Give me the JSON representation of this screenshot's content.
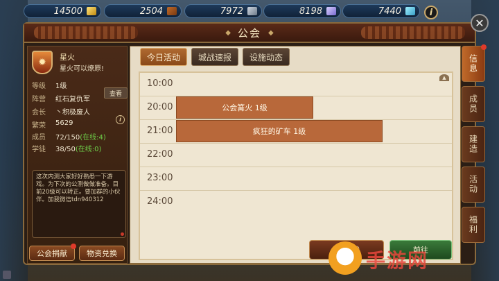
{
  "resources": [
    {
      "name": "gold",
      "value": "14500",
      "icon": "gold-icon"
    },
    {
      "name": "wood",
      "value": "2504",
      "icon": "wood-icon"
    },
    {
      "name": "iron",
      "value": "7972",
      "icon": "iron-icon"
    },
    {
      "name": "crystal",
      "value": "8198",
      "icon": "crystal-icon"
    },
    {
      "name": "gem",
      "value": "7440",
      "icon": "gem-icon"
    }
  ],
  "window": {
    "title": "公会",
    "close_label": "✕"
  },
  "guild": {
    "emblem_icon": "flame-emblem-icon",
    "name": "星火",
    "motto": "星火可以燎原!",
    "fields": [
      {
        "label": "等级",
        "value": "1级"
      },
      {
        "label": "阵营",
        "value": "红石复仇军"
      },
      {
        "label": "会长",
        "value": "丶积极废人"
      },
      {
        "label": "繁荣",
        "value": "5629"
      },
      {
        "label": "成员",
        "value": "72/150",
        "extra": "(在线:4)"
      },
      {
        "label": "学徒",
        "value": "38/50",
        "extra": "(在线:0)"
      }
    ],
    "view_label": "查看",
    "notice": "这次内测大家好好熟悉一下游戏。为下次的公测做做准备。目前20级可以转正。要加群的小伙伴。加我微信tdn940312",
    "donate_label": "公会捐献",
    "exchange_label": "物资兑换"
  },
  "tabs": [
    {
      "label": "今日活动",
      "active": true
    },
    {
      "label": "城战速报",
      "active": false
    },
    {
      "label": "设施动态",
      "active": false
    }
  ],
  "schedule": {
    "times": [
      "10:00",
      "20:00",
      "21:00",
      "22:00",
      "23:00",
      "24:00"
    ],
    "events": [
      {
        "label": "公会篝火 1级",
        "slot": 1
      },
      {
        "label": "疯狂的矿车 1级",
        "slot": 2
      }
    ]
  },
  "side_tabs": [
    {
      "label": "信息",
      "active": true,
      "dot": true
    },
    {
      "label": "成员",
      "active": false
    },
    {
      "label": "建造",
      "active": false
    },
    {
      "label": "活动",
      "active": false
    },
    {
      "label": "福利",
      "active": false
    }
  ],
  "bottom_buttons": {
    "battle": "城战",
    "go": "前往"
  },
  "watermark": "手游网",
  "colors": {
    "accent": "#b8683a",
    "online": "#6fd24a",
    "panel": "#2b1e15"
  }
}
